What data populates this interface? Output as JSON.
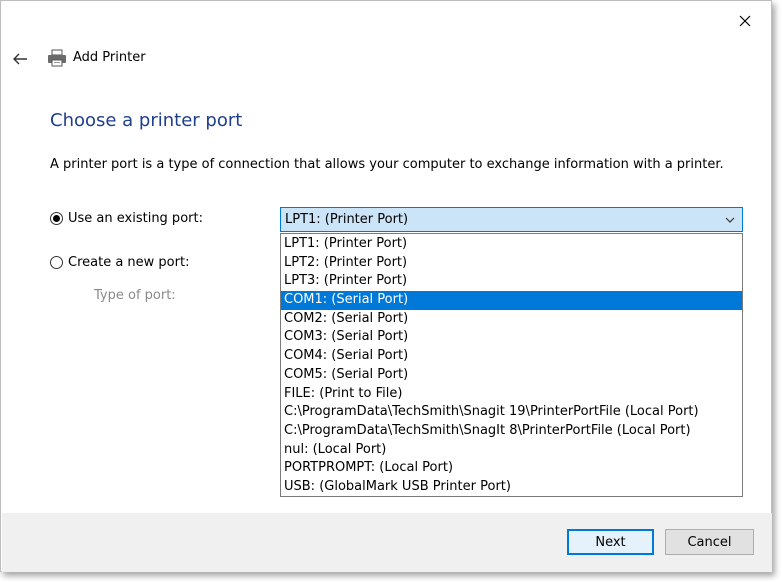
{
  "window": {
    "title": "Add Printer",
    "close_icon": "close-icon",
    "back_icon": "back-arrow-icon",
    "printer_icon": "printer-icon"
  },
  "page": {
    "title": "Choose a printer port",
    "description": "A printer port is a type of connection that allows your computer to exchange information with a printer."
  },
  "options": {
    "existing_label": "Use an existing port:",
    "existing_selected": true,
    "new_label": "Create a new port:",
    "new_selected": false,
    "type_label": "Type of port:"
  },
  "port_select": {
    "value": "LPT1: (Printer Port)",
    "selected_index": 3,
    "items": [
      "LPT1: (Printer Port)",
      "LPT2: (Printer Port)",
      "LPT3: (Printer Port)",
      "COM1: (Serial Port)",
      "COM2: (Serial Port)",
      "COM3: (Serial Port)",
      "COM4: (Serial Port)",
      "COM5: (Serial Port)",
      "FILE: (Print to File)",
      "C:\\ProgramData\\TechSmith\\Snagit 19\\PrinterPortFile (Local Port)",
      "C:\\ProgramData\\TechSmith\\SnagIt 8\\PrinterPortFile (Local Port)",
      "nul: (Local Port)",
      "PORTPROMPT: (Local Port)",
      "USB: (GlobalMark USB Printer Port)"
    ]
  },
  "footer": {
    "next_label": "Next",
    "cancel_label": "Cancel"
  },
  "colors": {
    "accent": "#0078d7",
    "title": "#1e3f8c",
    "combo_bg": "#cce4f7"
  }
}
